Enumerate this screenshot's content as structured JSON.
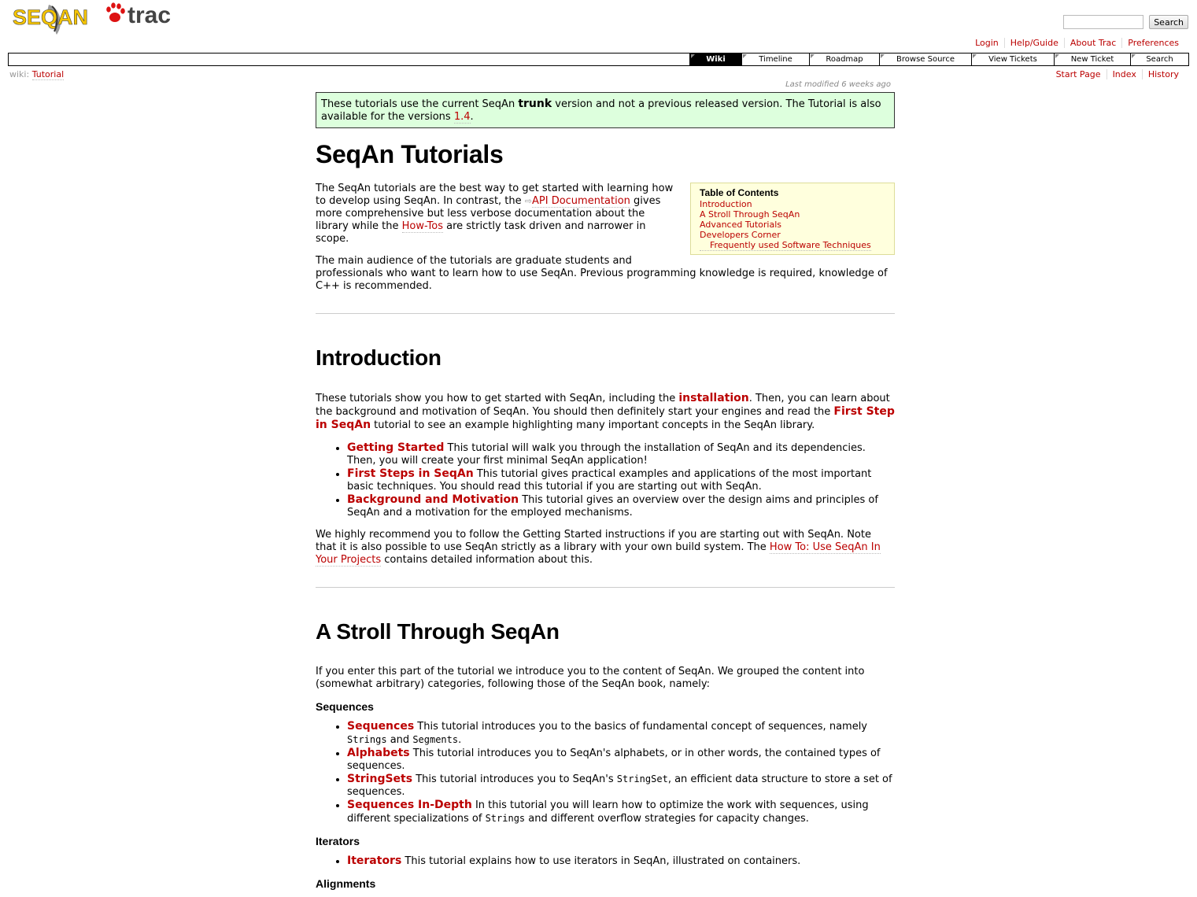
{
  "header": {
    "logo_seqan": "SEQAN",
    "logo_trac": "trac",
    "search_button": "Search",
    "metanav": [
      "Login",
      "Help/Guide",
      "About Trac",
      "Preferences"
    ]
  },
  "mainnav": [
    "Wiki",
    "Timeline",
    "Roadmap",
    "Browse Source",
    "View Tickets",
    "New Ticket",
    "Search"
  ],
  "ctxt": {
    "path_label": "wiki:",
    "path_link": "Tutorial",
    "nav": [
      "Start Page",
      "Index",
      "History"
    ]
  },
  "page": {
    "last_modified": "Last modified 6 weeks ago",
    "notice": {
      "pre": "These tutorials use the current SeqAn ",
      "bold": "trunk",
      "mid": " version and not a previous released version. The Tutorial is also available for the versions ",
      "link": "1.4",
      "post": "."
    },
    "title": "SeqAn Tutorials",
    "toc": {
      "title": "Table of Contents",
      "items": [
        "Introduction",
        "A Stroll Through SeqAn",
        "Advanced Tutorials",
        "Developers Corner"
      ],
      "subitem": "Frequently used Software Techniques"
    },
    "intro_p1": {
      "a": "The SeqAn tutorials are the best way to get started with learning how to develop using SeqAn. In contrast, the ",
      "link1": "API Documentation",
      "b": " gives more comprehensive but less verbose documentation about the library while the ",
      "link2": "How-Tos",
      "c": " are strictly task driven and narrower in scope."
    },
    "intro_p2": "The main audience of the tutorials are graduate students and professionals who want to learn how to use SeqAn. Previous programming knowledge is required, knowledge of C++ is recommended.",
    "introduction": {
      "heading": "Introduction",
      "p1": {
        "a": "These tutorials show you how to get started with SeqAn, including the ",
        "link1": "installation",
        "b": ". Then, you can learn about the background and motivation of SeqAn. You should then definitely start your engines and read the ",
        "link2": "First Step in SeqAn",
        "c": " tutorial to see an example highlighting many important concepts in the SeqAn library."
      },
      "items": [
        {
          "link": "Getting Started",
          "text": " This tutorial will walk you through the installation of SeqAn and its dependencies. Then, you will create your first minimal SeqAn application!"
        },
        {
          "link": "First Steps in SeqAn",
          "text": " This tutorial gives practical examples and applications of the most important basic techniques. You should read this tutorial if you are starting out with SeqAn."
        },
        {
          "link": "Background and Motivation",
          "text": " This tutorial gives an overview over the design aims and principles of SeqAn and a motivation for the employed mechanisms."
        }
      ],
      "p2": {
        "a": "We highly recommend you to follow the Getting Started instructions if you are starting out with SeqAn. Note that it is also possible to use SeqAn strictly as a library with your own build system. The ",
        "link": "How To: Use SeqAn In Your Projects",
        "b": " contains detailed information about this."
      }
    },
    "stroll": {
      "heading": "A Stroll Through SeqAn",
      "p1": "If you enter this part of the tutorial we introduce you to the content of SeqAn. We grouped the content into (somewhat arbitrary) categories, following those of the SeqAn book, namely:",
      "sequences_heading": "Sequences",
      "seq_items": [
        {
          "link": "Sequences",
          "a": " This tutorial introduces you to the basics of fundamental concept of sequences, namely ",
          "code1": "Strings",
          "b": " and ",
          "code2": "Segments",
          "c": "."
        },
        {
          "link": "Alphabets",
          "a": " This tutorial introduces you to SeqAn's alphabets, or in other words, the contained types of sequences."
        },
        {
          "link": "StringSets",
          "a": " This tutorial introduces you to SeqAn's ",
          "code1": "StringSet",
          "b": ", an efficient data structure to store a set of sequences."
        },
        {
          "link": "Sequences In-Depth",
          "a": " In this tutorial you will learn how to optimize the work with sequences, using different specializations of ",
          "code1": "Strings",
          "b": " and different overflow strategies for capacity changes."
        }
      ],
      "iterators_heading": "Iterators",
      "iter_items": [
        {
          "link": "Iterators",
          "a": " This tutorial explains how to use iterators in SeqAn, illustrated on containers."
        }
      ],
      "alignments_heading": "Alignments"
    }
  }
}
